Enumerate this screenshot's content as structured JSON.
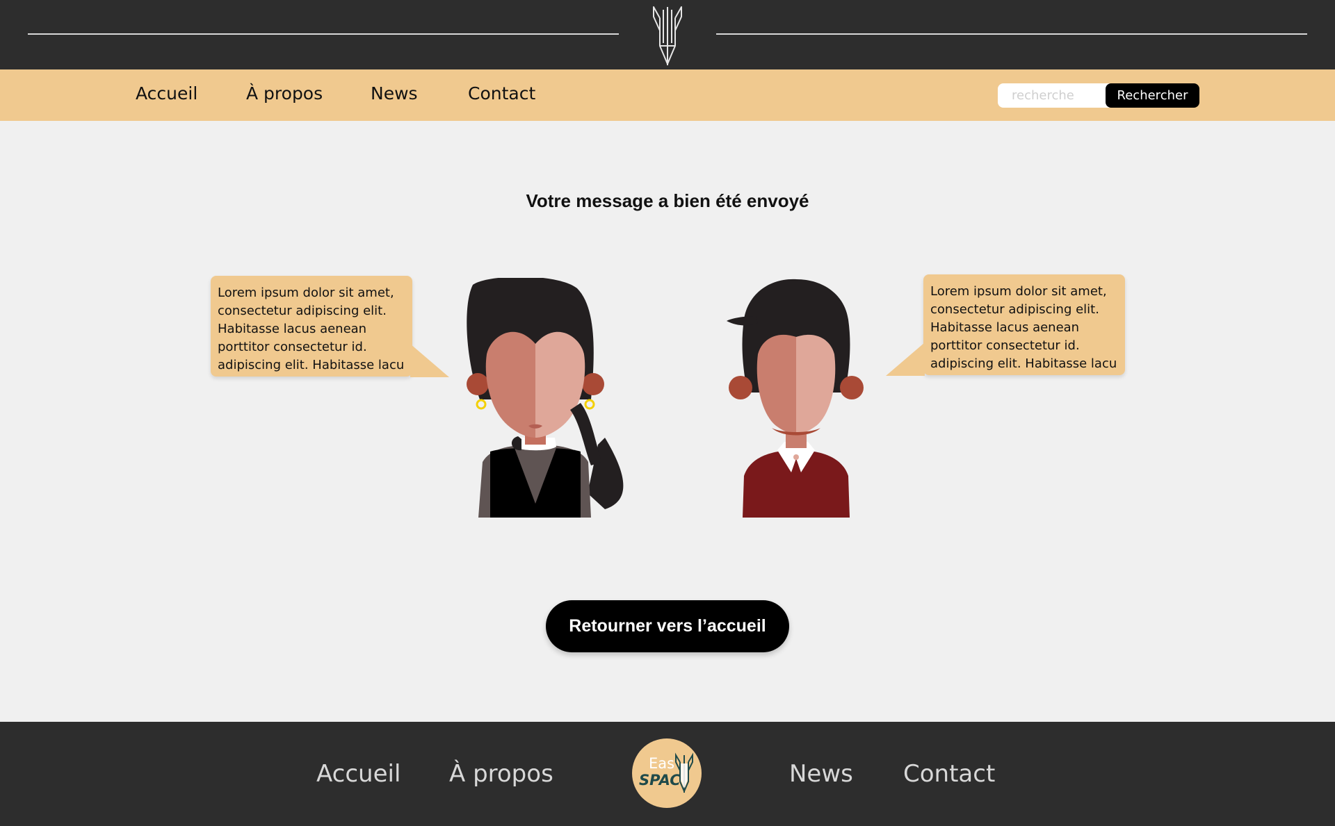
{
  "nav": {
    "items": [
      "Accueil",
      "À propos",
      "News",
      "Contact"
    ]
  },
  "search": {
    "placeholder": "recherche",
    "button_label": "Rechercher"
  },
  "main": {
    "message": "Votre message a bien été envoyé",
    "bubbles": [
      "Lorem ipsum dolor sit amet, consectetur adipiscing elit. Habitasse lacus aenean porttitor consectetur id. adipiscing elit. Habitasse lacu",
      "Lorem ipsum dolor sit amet, consectetur adipiscing elit. Habitasse lacus aenean porttitor consectetur id. adipiscing elit. Habitasse lacu"
    ],
    "cta_label": "Retourner vers l’accueil"
  },
  "footer": {
    "items": [
      "Accueil",
      "À propos",
      "News",
      "Contact"
    ],
    "logo_line1": "Eas",
    "logo_line2": "SPAC"
  },
  "colors": {
    "dark": "#2d2d2d",
    "accent": "#f0c98f",
    "button": "#000000"
  }
}
